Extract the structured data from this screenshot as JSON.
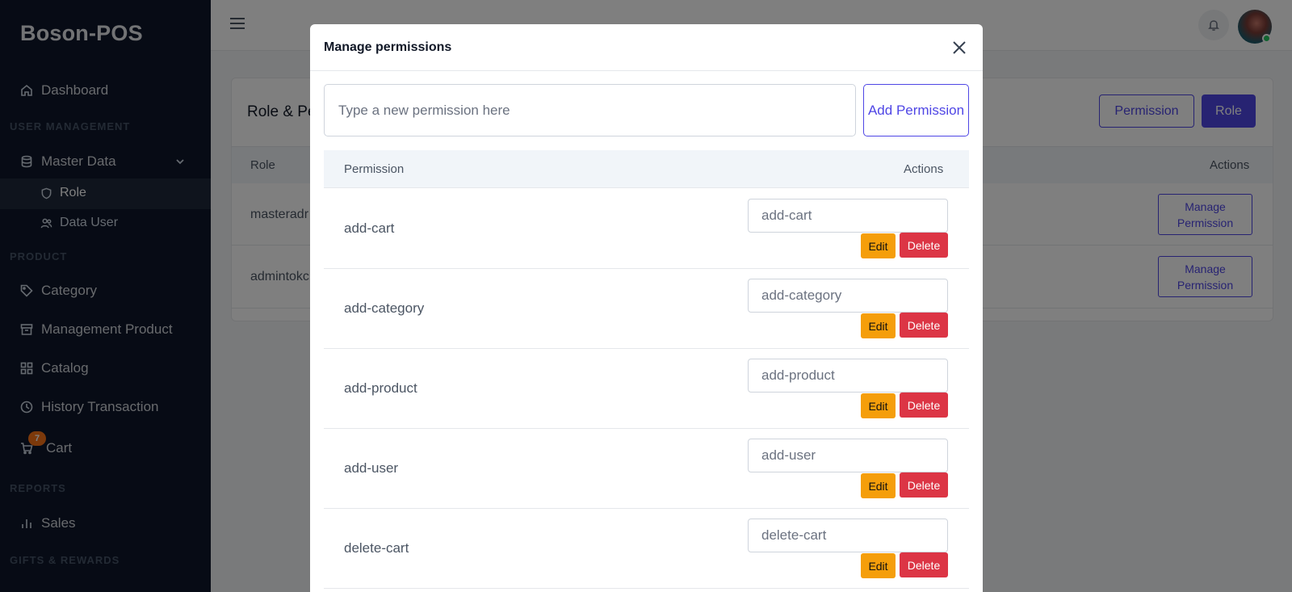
{
  "app": {
    "brand": "Boson-POS"
  },
  "sidebar": {
    "dashboard": "Dashboard",
    "sections": {
      "user_management": "USER MANAGEMENT",
      "product": "PRODUCT",
      "reports": "REPORTS",
      "gifts": "GIFTS & REWARDS"
    },
    "master_data": "Master Data",
    "role": "Role",
    "data_user": "Data User",
    "category": "Category",
    "management_product": "Management Product",
    "catalog": "Catalog",
    "history_transaction": "History Transaction",
    "cart": "Cart",
    "cart_count": "7",
    "sales": "Sales"
  },
  "page": {
    "title": "Role & Pe",
    "permission_button": "Permission",
    "role_button": "Role",
    "table": {
      "headers": {
        "role": "Role",
        "actions": "Actions"
      },
      "rows": [
        {
          "role": "masteradr",
          "action": "Manage Permission"
        },
        {
          "role": "admintokc",
          "action": "Manage Permission"
        }
      ]
    }
  },
  "modal": {
    "title": "Manage permissions",
    "new_permission_placeholder": "Type a new permission here",
    "add_button": "Add Permission",
    "headers": {
      "permission": "Permission",
      "actions": "Actions"
    },
    "edit_label": "Edit",
    "delete_label": "Delete",
    "permissions": [
      {
        "name": "add-cart",
        "value": "add-cart"
      },
      {
        "name": "add-category",
        "value": "add-category"
      },
      {
        "name": "add-product",
        "value": "add-product"
      },
      {
        "name": "add-user",
        "value": "add-user"
      },
      {
        "name": "delete-cart",
        "value": "delete-cart"
      }
    ]
  },
  "colors": {
    "sidebar_bg": "#0f172a",
    "accent": "#4f46e5",
    "edit": "#f59e0b",
    "delete": "#dc3545"
  }
}
